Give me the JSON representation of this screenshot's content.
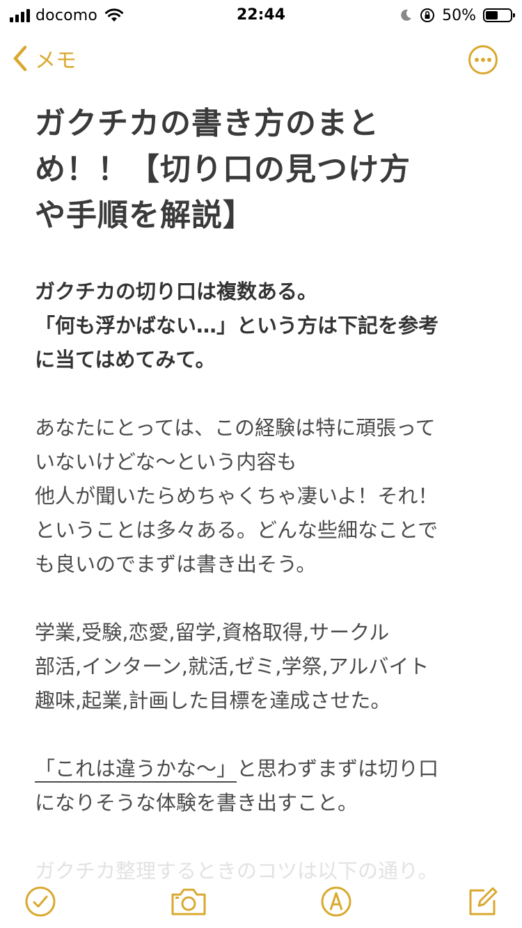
{
  "status_bar": {
    "carrier": "docomo",
    "time": "22:44",
    "battery_percent": "50%",
    "battery_level": 0.5
  },
  "nav": {
    "back_label": "メモ",
    "accent_color": "#d9a82e"
  },
  "note": {
    "title": [
      "ガクチカの書き方のまと",
      "め！！【切り口の見つけ方",
      "や手順を解説】"
    ],
    "intro_bold": [
      "ガクチカの切り口は複数ある。",
      "「何も浮かばない…」という方は下記を参考",
      "に当てはめてみて。"
    ],
    "para1": [
      "あなたにとっては、この経験は特に頑張って",
      "いないけどな〜という内容も",
      "他人が聞いたらめちゃくちゃ凄いよ！それ！",
      "ということは多々ある。どんな些細なことで",
      "も良いのでまずは書き出そう。"
    ],
    "para2": [
      "学業,受験,恋愛,留学,資格取得,サークル",
      "部活,インターン,就活,ゼミ,学祭,アルバイト",
      "趣味,起業,計画した目標を達成させた。"
    ],
    "para3_underlined": "「これは違うかな〜」",
    "para3_rest": "と思わずまずは切り口",
    "para3_line2": "になりそうな体験を書き出すこと。",
    "faded_line": "ガクチカ整理するときのコツは以下の通り。"
  },
  "toolbar": {
    "icons": [
      "checkmark-icon",
      "camera-icon",
      "markup-icon",
      "compose-icon"
    ]
  }
}
